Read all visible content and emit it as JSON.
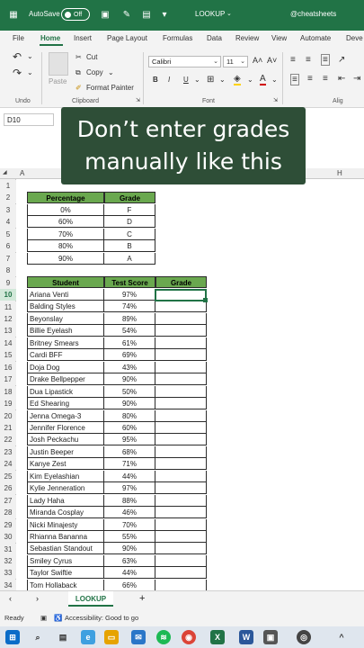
{
  "titlebar": {
    "autosave_label": "AutoSave",
    "toggle_state": "Off",
    "doc_title": "LOOKUP",
    "handle": "@cheatsheets"
  },
  "menu": {
    "tabs": [
      "File",
      "Home",
      "Insert",
      "Page Layout",
      "Formulas",
      "Data",
      "Review",
      "View",
      "Automate",
      "Deve"
    ],
    "active": "Home"
  },
  "ribbon": {
    "cut": "Cut",
    "copy": "Copy",
    "paste": "Paste",
    "format_painter": "Format Painter",
    "font_name": "Calibri",
    "font_size": "11",
    "groups": {
      "undo": "Undo",
      "clipboard": "Clipboard",
      "font": "Font",
      "align": "Alig"
    }
  },
  "namebox": "D10",
  "caption": {
    "line1": "Don’t enter grades",
    "line2": "manually like this"
  },
  "columns": {
    "a": "A",
    "h": "H"
  },
  "lookup_table": {
    "headers": [
      "Percentage",
      "Grade"
    ],
    "rows": [
      [
        "0%",
        "F"
      ],
      [
        "60%",
        "D"
      ],
      [
        "70%",
        "C"
      ],
      [
        "80%",
        "B"
      ],
      [
        "90%",
        "A"
      ]
    ]
  },
  "students_table": {
    "headers": [
      "Student",
      "Test Score",
      "Grade"
    ],
    "rows": [
      [
        "Ariana Venti",
        "97%"
      ],
      [
        "Balding Styles",
        "74%"
      ],
      [
        "Beyonslay",
        "89%"
      ],
      [
        "Billie Eyelash",
        "54%"
      ],
      [
        "Britney Smears",
        "61%"
      ],
      [
        "Cardi BFF",
        "69%"
      ],
      [
        "Doja Dog",
        "43%"
      ],
      [
        "Drake Bellpepper",
        "90%"
      ],
      [
        "Dua Lipastick",
        "50%"
      ],
      [
        "Ed Shearing",
        "90%"
      ],
      [
        "Jenna Omega-3",
        "80%"
      ],
      [
        "Jennifer Florence",
        "60%"
      ],
      [
        "Josh Peckachu",
        "95%"
      ],
      [
        "Justin Beeper",
        "68%"
      ],
      [
        "Kanye Zest",
        "71%"
      ],
      [
        "Kim Eyelashian",
        "44%"
      ],
      [
        "Kylie Jenneration",
        "97%"
      ],
      [
        "Lady Haha",
        "88%"
      ],
      [
        "Miranda Cosplay",
        "46%"
      ],
      [
        "Nicki Minajesty",
        "70%"
      ],
      [
        "Rhianna Bananna",
        "55%"
      ],
      [
        "Sebastian Standout",
        "90%"
      ],
      [
        "Smiley Cyrus",
        "63%"
      ],
      [
        "Taylor Swiftie",
        "44%"
      ],
      [
        "Tom Hollaback",
        "66%"
      ]
    ]
  },
  "row_numbers": [
    "1",
    "2",
    "3",
    "4",
    "5",
    "6",
    "7",
    "8",
    "9",
    "10",
    "11",
    "12",
    "13",
    "14",
    "15",
    "16",
    "17",
    "18",
    "19",
    "20",
    "21",
    "22",
    "23",
    "24",
    "25",
    "26",
    "27",
    "28",
    "29",
    "30",
    "31",
    "32",
    "33",
    "34"
  ],
  "sheet_tab": "LOOKUP",
  "add_sheet": "+",
  "status": {
    "ready": "Ready",
    "accessibility": "Accessibility: Good to go"
  },
  "colors": {
    "excel_green": "#217346",
    "header_green": "#6aa84f",
    "caption_bg": "#2e4e37"
  }
}
